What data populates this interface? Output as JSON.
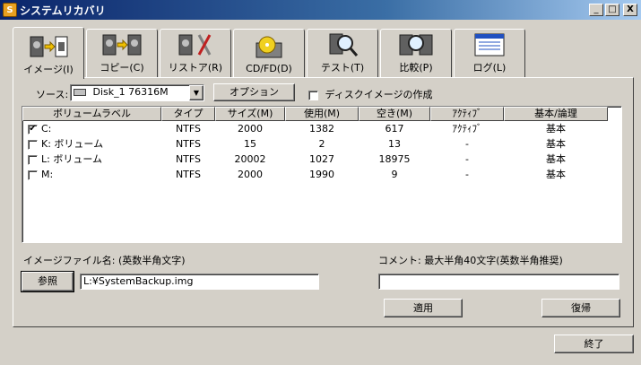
{
  "window": {
    "title": "システムリカバリ",
    "minimize": "_",
    "maximize": "□",
    "close": "X"
  },
  "tabs": [
    {
      "label": "イメージ(I)",
      "icon": "disk-to-file-icon"
    },
    {
      "label": "コピー(C)",
      "icon": "disk-to-disk-icon"
    },
    {
      "label": "リストア(R)",
      "icon": "restore-tools-icon"
    },
    {
      "label": "CD/FD(D)",
      "icon": "cd-drive-icon"
    },
    {
      "label": "テスト(T)",
      "icon": "magnifier-disk-icon"
    },
    {
      "label": "比較(P)",
      "icon": "compare-disk-icon"
    },
    {
      "label": "ログ(L)",
      "icon": "log-window-icon"
    }
  ],
  "source": {
    "label": "ソース:",
    "value": "Disk_1   76316M"
  },
  "options_button": "オプション",
  "create_image_label": "ディスクイメージの作成",
  "table": {
    "headers": [
      "ボリュームラベル",
      "タイプ",
      "サイズ(M)",
      "使用(M)",
      "空き(M)",
      "ｱｸﾃｨﾌﾞ",
      "基本/論理"
    ],
    "rows": [
      {
        "checked": true,
        "cells": [
          "C:",
          "NTFS",
          "2000",
          "1382",
          "617",
          "ｱｸﾃｨﾌﾞ",
          "基本"
        ]
      },
      {
        "checked": false,
        "cells": [
          "K: ボリューム",
          "NTFS",
          "15",
          "2",
          "13",
          "-",
          "基本"
        ]
      },
      {
        "checked": false,
        "cells": [
          "L: ボリューム",
          "NTFS",
          "20002",
          "1027",
          "18975",
          "-",
          "基本"
        ]
      },
      {
        "checked": false,
        "cells": [
          "M:",
          "NTFS",
          "2000",
          "1990",
          "9",
          "-",
          "基本"
        ]
      }
    ]
  },
  "image_file": {
    "label": "イメージファイル名: (英数半角文字)",
    "browse": "参照",
    "value": "L:¥SystemBackup.img"
  },
  "comment": {
    "label": "コメント: 最大半角40文字(英数半角推奨)",
    "value": ""
  },
  "apply_button": "適用",
  "restore_button": "復帰",
  "exit_button": "終了"
}
